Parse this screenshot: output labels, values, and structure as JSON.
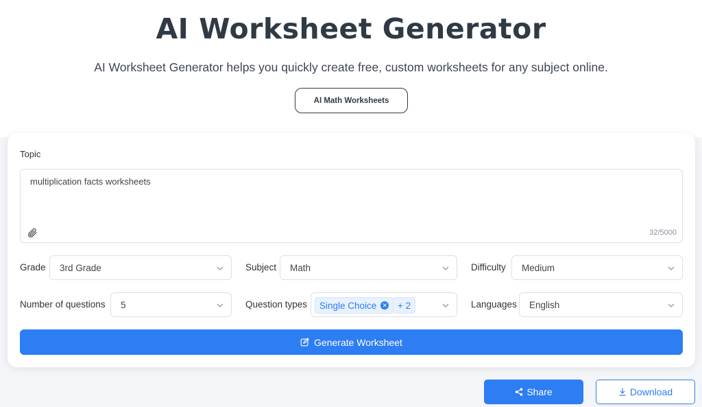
{
  "header": {
    "title": "AI Worksheet Generator",
    "subtitle": "AI Worksheet Generator helps you quickly create free, custom worksheets for any subject online.",
    "pill_label": "AI Math Worksheets"
  },
  "form": {
    "topic_label": "Topic",
    "topic_value": "multiplication facts worksheets",
    "counter": "32/5000",
    "grade": {
      "label": "Grade",
      "value": "3rd Grade"
    },
    "subject": {
      "label": "Subject",
      "value": "Math"
    },
    "difficulty": {
      "label": "Difficulty",
      "value": "Medium"
    },
    "num_questions": {
      "label": "Number of questions",
      "value": "5"
    },
    "question_types": {
      "label": "Question types",
      "tag": "Single Choice",
      "more": "+ 2"
    },
    "languages": {
      "label": "Languages",
      "value": "English"
    },
    "generate_label": "Generate Worksheet"
  },
  "actions": {
    "share_label": "Share",
    "download_label": "Download"
  },
  "colors": {
    "accent": "#2d7df3",
    "title": "#2f3a45"
  },
  "icons": {
    "attach": "paperclip-icon",
    "chevron": "chevron-down-icon",
    "edit": "edit-icon",
    "share": "share-icon",
    "download": "download-icon"
  }
}
